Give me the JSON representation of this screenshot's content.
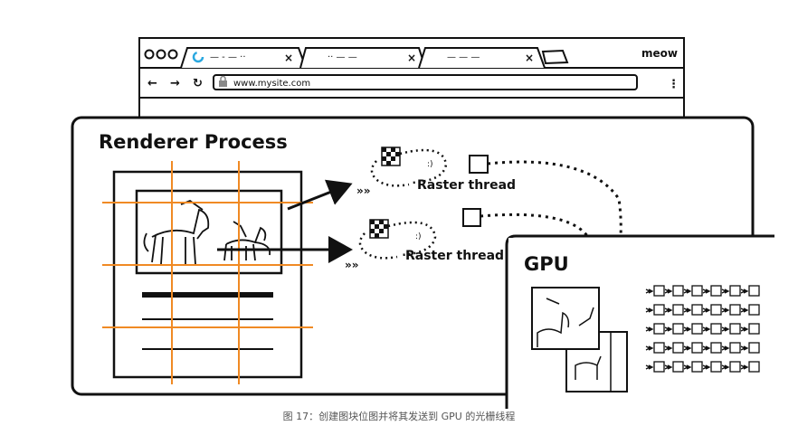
{
  "browser": {
    "brand": "meow",
    "url": "www.mysite.com",
    "tabs": [
      {
        "title": "— - — ·· "
      },
      {
        "title": "·· — —"
      },
      {
        "title": "— — —"
      }
    ]
  },
  "renderer": {
    "title": "Renderer Process"
  },
  "raster_threads": [
    {
      "label": "Raster thread"
    },
    {
      "label": "Raster thread"
    }
  ],
  "gpu": {
    "title": "GPU"
  },
  "caption": "图 17：创建图块位图并将其发送到 GPU 的光栅线程",
  "colors": {
    "grid": "#f08a24",
    "ink": "#111111",
    "loading": "#2aa8e0"
  }
}
